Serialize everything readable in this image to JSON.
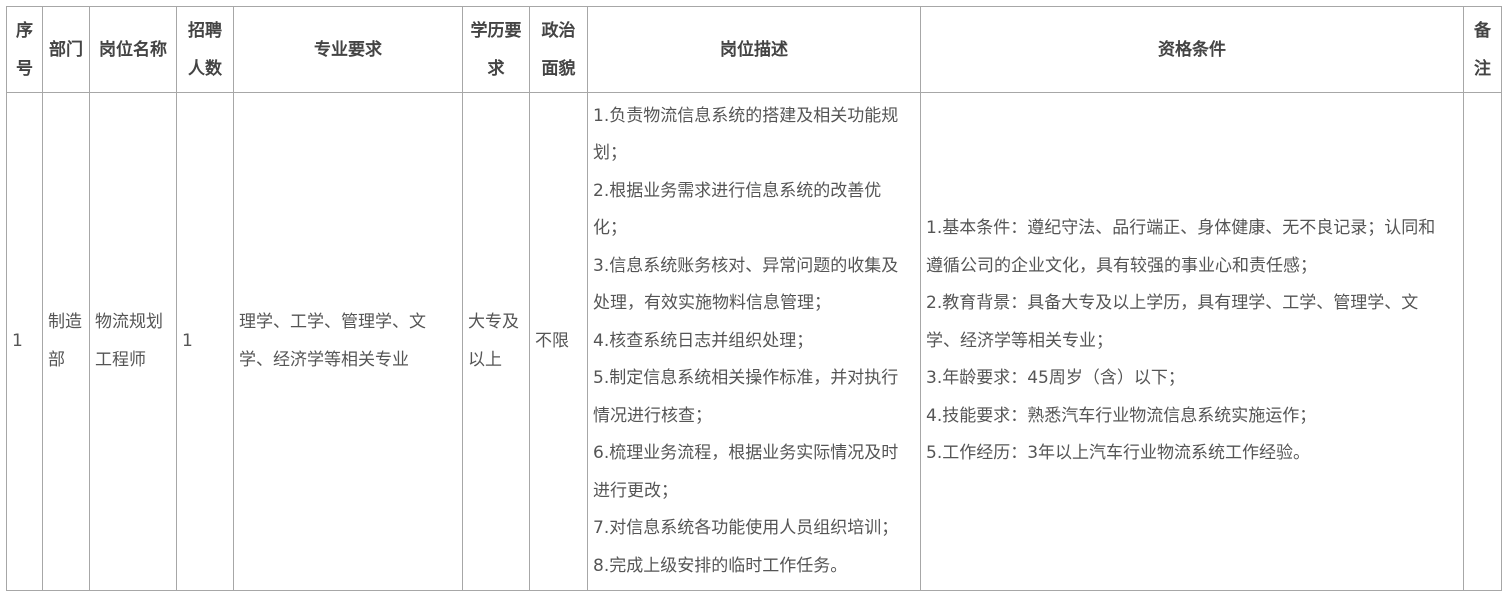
{
  "headers": {
    "seq": [
      "序",
      "号"
    ],
    "dept": "部门",
    "post": "岗位名称",
    "count": [
      "招聘",
      "人数"
    ],
    "major": "专业要求",
    "edu": [
      "学历要",
      "求"
    ],
    "political": [
      "政治",
      "面貌"
    ],
    "desc": "岗位描述",
    "qual": "资格条件",
    "note": [
      "备",
      "注"
    ]
  },
  "rows": [
    {
      "seq": "1",
      "dept": [
        "制造",
        "部"
      ],
      "post": [
        "物流规划",
        "工程师"
      ],
      "count": "1",
      "major": [
        "理学、工学、管理学、文",
        "学、经济学等相关专业"
      ],
      "edu": [
        "大专及",
        "以上"
      ],
      "political": "不限",
      "desc": [
        "1.负责物流信息系统的搭建及相关功能规",
        "划；",
        "2.根据业务需求进行信息系统的改善优",
        "化；",
        "3.信息系统账务核对、异常问题的收集及",
        "处理，有效实施物料信息管理；",
        "4.核查系统日志并组织处理；",
        "5.制定信息系统相关操作标准，并对执行",
        "情况进行核查；",
        "6.梳理业务流程，根据业务实际情况及时",
        "进行更改；",
        "7.对信息系统各功能使用人员组织培训；",
        "8.完成上级安排的临时工作任务。"
      ],
      "qual": [
        "1.基本条件：遵纪守法、品行端正、身体健康、无不良记录；认同和",
        "遵循公司的企业文化，具有较强的事业心和责任感；",
        "2.教育背景：具备大专及以上学历，具有理学、工学、管理学、文",
        "学、经济学等相关专业；",
        "3.年龄要求：45周岁（含）以下；",
        "4.技能要求：熟悉汽车行业物流信息系统实施运作；",
        "5.工作经历：3年以上汽车行业物流系统工作经验。"
      ],
      "note": ""
    }
  ]
}
